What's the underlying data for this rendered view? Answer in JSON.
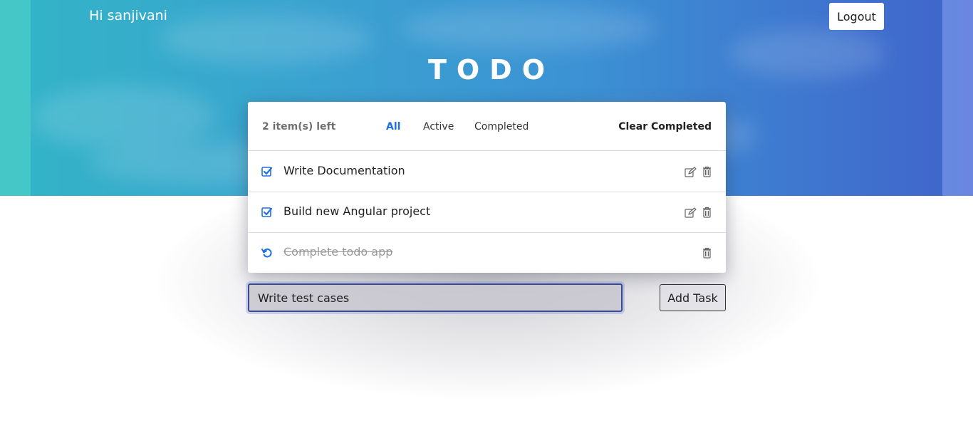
{
  "header": {
    "greeting": "Hi sanjivani",
    "logout_label": "Logout",
    "title": "TODO"
  },
  "todo_card": {
    "items_left": "2 item(s) left",
    "filters": [
      {
        "label": "All",
        "active": true
      },
      {
        "label": "Active",
        "active": false
      },
      {
        "label": "Completed",
        "active": false
      }
    ],
    "clear_completed_label": "Clear Completed",
    "items": [
      {
        "text": "Write Documentation",
        "completed": false,
        "status_icon": "checkbox-checked-icon",
        "actions": [
          "edit-icon",
          "trash-icon"
        ]
      },
      {
        "text": "Build new Angular project",
        "completed": false,
        "status_icon": "checkbox-checked-icon",
        "actions": [
          "edit-icon",
          "trash-icon"
        ]
      },
      {
        "text": "Complete todo app",
        "completed": true,
        "status_icon": "undo-icon",
        "actions": [
          "trash-icon"
        ]
      }
    ]
  },
  "new_task": {
    "value": "Write test cases",
    "add_label": "Add Task"
  },
  "colors": {
    "accent": "#1e6fe0",
    "hero_start": "#33b3c8",
    "hero_end": "#4067cc"
  }
}
